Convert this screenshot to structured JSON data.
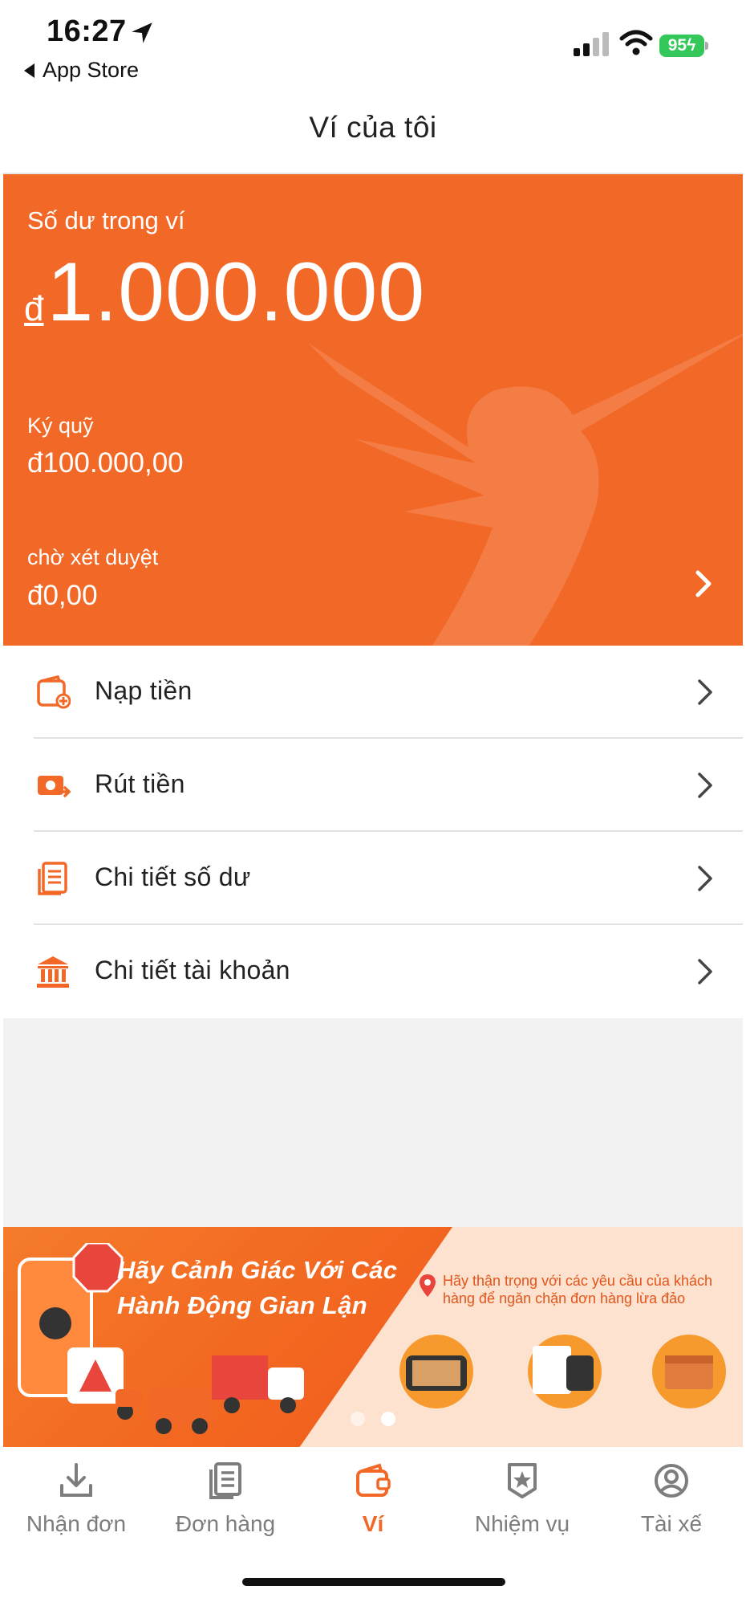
{
  "status_bar": {
    "time": "16:27",
    "back_label": "App Store",
    "battery": "95"
  },
  "header": {
    "title": "Ví của tôi"
  },
  "wallet": {
    "balance_label": "Số dư trong ví",
    "currency_symbol": "đ",
    "balance_value": "1.000.000",
    "deposit_label": "Ký quỹ",
    "deposit_value": "đ100.000,00",
    "pending_label": "chờ xét duyệt",
    "pending_value": "đ0,00",
    "accent_color": "#f26826"
  },
  "menu": {
    "items": [
      {
        "label": "Nạp tiền",
        "icon": "wallet-add-icon"
      },
      {
        "label": "Rút tiền",
        "icon": "cash-withdraw-icon"
      },
      {
        "label": "Chi tiết số dư",
        "icon": "document-list-icon"
      },
      {
        "label": "Chi tiết tài khoản",
        "icon": "bank-icon"
      }
    ]
  },
  "banner": {
    "headline_line1": "Hãy Cảnh Giác Với Các",
    "headline_line2": "Hành Động Gian Lận",
    "note": "Hãy thận trọng với các yêu cầu của khách hàng để ngăn chặn đơn hàng lừa đảo",
    "page_count": 2,
    "active_page": 2
  },
  "tabbar": {
    "tabs": [
      {
        "label": "Nhận đơn",
        "icon": "download-icon",
        "active": false
      },
      {
        "label": "Đơn hàng",
        "icon": "orders-icon",
        "active": false
      },
      {
        "label": "Ví",
        "icon": "wallet-icon",
        "active": true
      },
      {
        "label": "Nhiệm vụ",
        "icon": "mission-badge-icon",
        "active": false
      },
      {
        "label": "Tài xế",
        "icon": "driver-profile-icon",
        "active": false
      }
    ]
  }
}
